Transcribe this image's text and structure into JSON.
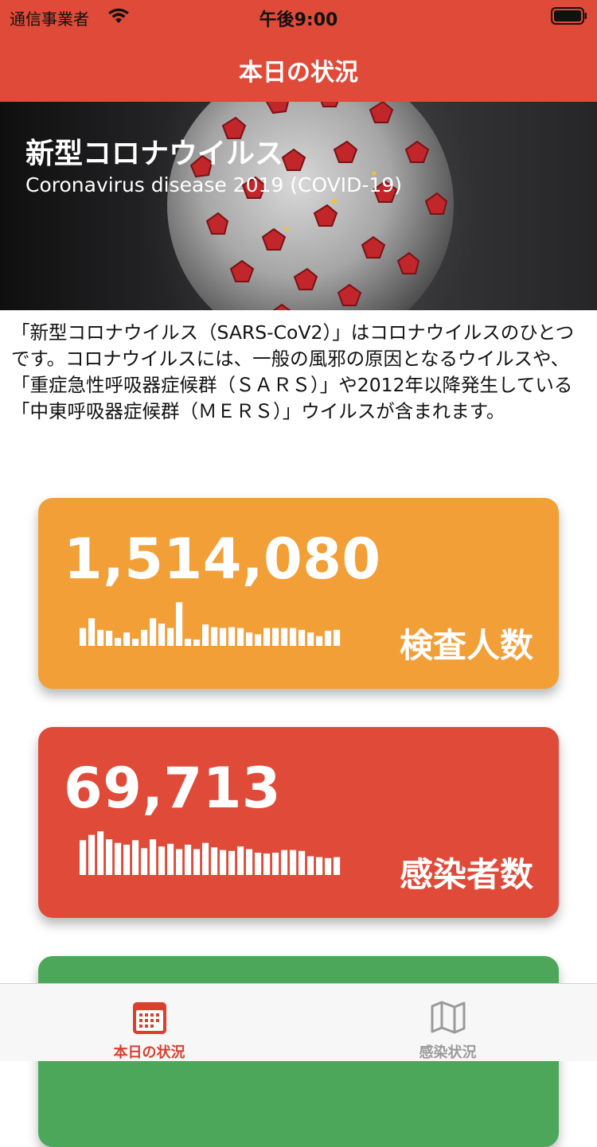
{
  "status_bar": {
    "carrier": "通信事業者",
    "time": "午後9:00"
  },
  "nav": {
    "title": "本日の状況"
  },
  "hero": {
    "title": "新型コロナウイルス",
    "subtitle": "Coronavirus disease 2019 (COVID-19)"
  },
  "intro": {
    "text": "「新型コロナウイルス（SARS-CoV2）」はコロナウイルスのひとつです。コロナウイルスには、一般の風邪の原因となるウイルスや、「重症急性呼吸器症候群（ＳＡＲＳ）」や2012年以降発生している「中東呼吸器症候群（ＭＥＲＳ）」ウイルスが含まれます。"
  },
  "cards": [
    {
      "value": "1,514,080",
      "label": "検査人数",
      "color": "#f29f38",
      "spark": [
        0.4,
        0.62,
        0.36,
        0.34,
        0.18,
        0.3,
        0.16,
        0.36,
        0.62,
        0.5,
        0.4,
        0.98,
        0.16,
        0.14,
        0.48,
        0.42,
        0.4,
        0.42,
        0.4,
        0.3,
        0.26,
        0.4,
        0.4,
        0.4,
        0.4,
        0.36,
        0.3,
        0.22,
        0.34,
        0.36
      ]
    },
    {
      "value": "69,713",
      "label": "感染者数",
      "color": "#df4a39",
      "spark": [
        0.78,
        0.9,
        0.98,
        0.8,
        0.72,
        0.68,
        0.78,
        0.6,
        0.8,
        0.64,
        0.7,
        0.58,
        0.68,
        0.58,
        0.72,
        0.62,
        0.56,
        0.54,
        0.64,
        0.58,
        0.5,
        0.48,
        0.5,
        0.56,
        0.56,
        0.54,
        0.42,
        0.4,
        0.38,
        0.4
      ]
    },
    {
      "value": "",
      "label": "",
      "color": "#4ca75a",
      "spark": []
    }
  ],
  "tabs": [
    {
      "label": "本日の状況",
      "icon": "calendar-icon",
      "active": true
    },
    {
      "label": "感染状況",
      "icon": "map-icon",
      "active": false
    }
  ],
  "colors": {
    "accent": "#e04a38",
    "tab_active": "#d9402f",
    "tab_inactive": "#9a9a9a"
  }
}
